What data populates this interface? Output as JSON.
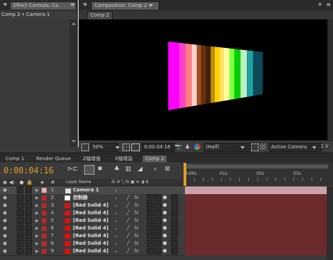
{
  "effect_controls": {
    "tab_label": "Effect Controls: Ca",
    "subtitle": "Comp 2 • Camera 1"
  },
  "composition": {
    "tab_label": "Composition: Comp 2",
    "sub_tab": "Comp 2",
    "zoom": "50%",
    "timecode": "0:00:04:16",
    "resolution": "(Half)",
    "view": "Active Camera",
    "view_count": "1 V"
  },
  "bottom_tabs": [
    "Comp 1",
    "Render Queue",
    "Z轴增值",
    "X轴增益",
    "Comp 2"
  ],
  "timeline": {
    "current_time": "0:00:04:16",
    "layer_name_header": "Layer Name",
    "switch_header": "⁂ ✲ ╲ fx ▣ ⊘ ◑ ⧈",
    "ruler_marks": [
      "0:00s",
      "01s",
      "02s",
      "03s"
    ],
    "layers": [
      {
        "num": "1",
        "name": "Camera 1",
        "color": "#e8b0b8"
      },
      {
        "num": "2",
        "name": "控制器",
        "color": "#b8282a"
      },
      {
        "num": "3",
        "name": "[Red Solid 4]",
        "color": "#b8282a"
      },
      {
        "num": "4",
        "name": "[Red Solid 4]",
        "color": "#b8282a"
      },
      {
        "num": "5",
        "name": "[Red Solid 4]",
        "color": "#b8282a"
      },
      {
        "num": "6",
        "name": "[Red Solid 4]",
        "color": "#b8282a"
      },
      {
        "num": "7",
        "name": "[Red Solid 4]",
        "color": "#b8282a"
      },
      {
        "num": "8",
        "name": "[Red Solid 4]",
        "color": "#b8282a"
      },
      {
        "num": "9",
        "name": "[Red Solid 4]",
        "color": "#b8282a"
      }
    ]
  },
  "colors": {
    "accent_timecode": "#e0a020",
    "track_red": "#6b2a2c",
    "camera_track": "#c9a0a8",
    "panel_bg": "#3c3c3c"
  },
  "icons": [
    "hand-icon",
    "menu-icon",
    "close-icon",
    "camera-icon",
    "grid-icon",
    "search-icon",
    "eye-icon",
    "lock-icon",
    "triangle-icon",
    "fx-icon"
  ]
}
